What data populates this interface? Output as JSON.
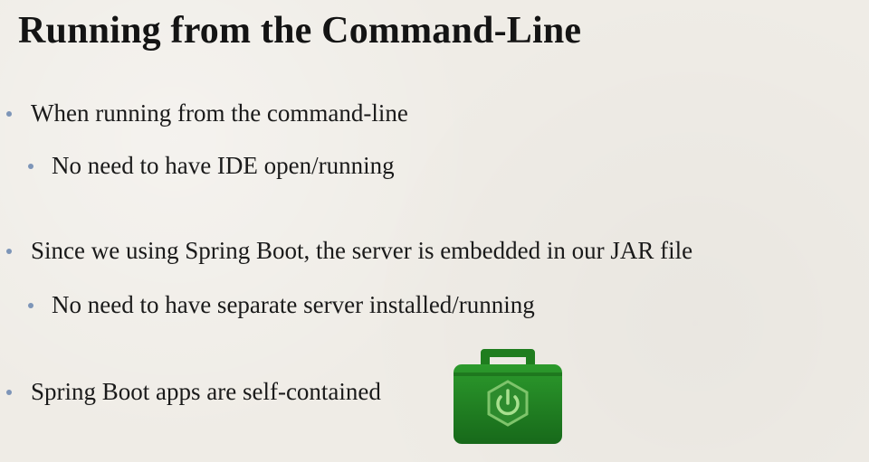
{
  "slide": {
    "title": "Running from the Command-Line",
    "bullets": [
      {
        "level": 1,
        "text": "When running from the command-line"
      },
      {
        "level": 2,
        "text": "No need to have IDE open/running"
      },
      {
        "level": 1,
        "text": "Since we using Spring Boot, the server is embedded in our JAR file"
      },
      {
        "level": 2,
        "text": "No need to have separate server installed/running"
      },
      {
        "level": 1,
        "text": "Spring Boot apps are self-contained"
      }
    ],
    "icon": "spring-boot-toolbox-icon",
    "colors": {
      "background": "#efece6",
      "bullet_dot": "#7d95b8",
      "icon_green": "#1f7d1f",
      "icon_light_green": "#7ec46b"
    }
  }
}
